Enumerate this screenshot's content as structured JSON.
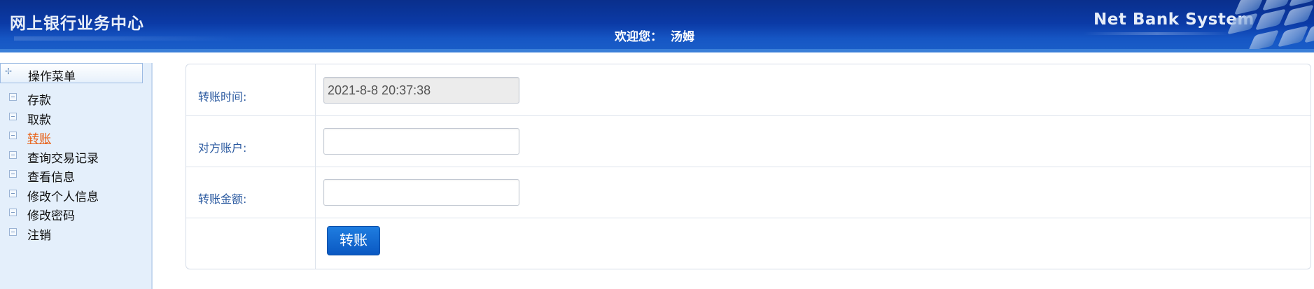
{
  "header": {
    "title": "网上银行业务中心",
    "welcome_label": "欢迎您：",
    "user_name": "汤姆",
    "brand": "Net Bank System"
  },
  "sidebar": {
    "heading": "操作菜单",
    "items": [
      {
        "label": "存款",
        "active": false
      },
      {
        "label": "取款",
        "active": false
      },
      {
        "label": "转账",
        "active": true
      },
      {
        "label": "查询交易记录",
        "active": false
      },
      {
        "label": "查看信息",
        "active": false
      },
      {
        "label": "修改个人信息",
        "active": false
      },
      {
        "label": "修改密码",
        "active": false
      },
      {
        "label": "注销",
        "active": false
      }
    ]
  },
  "form": {
    "transfer_time_label": "转账时间:",
    "transfer_time_value": "2021-8-8 20:37:38",
    "target_account_label": "对方账户:",
    "target_account_value": "",
    "amount_label": "转账金额:",
    "amount_value": "",
    "submit_label": "转账"
  },
  "colors": {
    "header_bg": "#0b3aa6",
    "active_menu": "#e8631a",
    "button_bg": "#0a58c2",
    "label_text": "#2b5aa0"
  }
}
